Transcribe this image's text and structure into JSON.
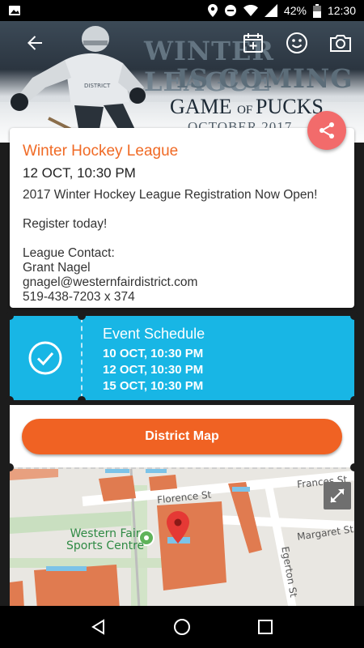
{
  "status_bar": {
    "battery_percent": "42%",
    "time": "12:30",
    "icons": [
      "image-icon",
      "location-icon",
      "do-not-disturb-icon",
      "wifi-icon",
      "signal-icon",
      "battery-icon"
    ]
  },
  "hero": {
    "line1": "WINTER LEAGUE",
    "line2": "IS COMING",
    "line3_a": "GAME ",
    "line3_b": "OF ",
    "line3_c": "PUCKS",
    "line4": "OCTOBER 2017"
  },
  "toolbar": {
    "back_icon": "arrow-back-icon",
    "add_calendar_icon": "calendar-add-icon",
    "smiley_icon": "smiley-icon",
    "camera_icon": "camera-icon"
  },
  "event": {
    "title": "Winter Hockey League",
    "date": "12 OCT, 10:30 PM",
    "body": "2017 Winter Hockey League Registration Now Open!\n\nRegister today!\n\nLeague Contact:\nGrant Nagel\ngnagel@westernfairdistrict.com\n519-438-7203 x 374"
  },
  "schedule": {
    "title": "Event Schedule",
    "dates": [
      "10 OCT, 10:30 PM",
      "12 OCT, 10:30 PM",
      "15 OCT, 10:30 PM"
    ]
  },
  "map": {
    "button_label": "District Map",
    "labels": {
      "place": "Western Fair\nSports Centre",
      "street1": "Florence St",
      "street2": "Frances St",
      "street3": "Margaret St",
      "street4": "Egerton St"
    }
  },
  "colors": {
    "accent_orange": "#f06a25",
    "schedule_blue": "#18b6e5",
    "share_red": "#f26b6b"
  }
}
